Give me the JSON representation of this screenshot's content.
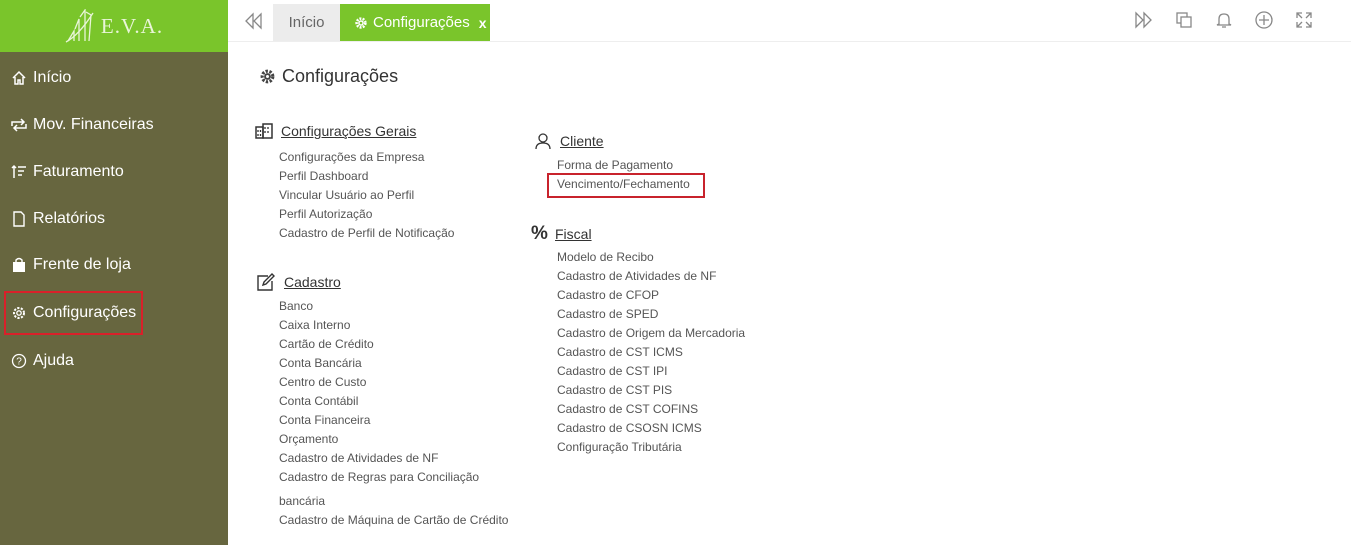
{
  "logo": {
    "text": "E.V.A."
  },
  "sidebar": {
    "items": [
      {
        "label": "Início",
        "icon": "home-icon"
      },
      {
        "label": "Mov. Financeiras",
        "icon": "swap-icon"
      },
      {
        "label": "Faturamento",
        "icon": "sort-icon"
      },
      {
        "label": "Relatórios",
        "icon": "file-icon"
      },
      {
        "label": "Frente de loja",
        "icon": "bag-icon"
      },
      {
        "label": "Configurações",
        "icon": "gear-icon"
      },
      {
        "label": "Ajuda",
        "icon": "help-icon"
      }
    ]
  },
  "tabs": [
    {
      "label": "Início"
    },
    {
      "label": "Configurações",
      "close": "x"
    }
  ],
  "page": {
    "title": "Configurações"
  },
  "sections": {
    "gerais": {
      "title": "Configurações Gerais",
      "items": [
        "Configurações da Empresa",
        "Perfil Dashboard",
        "Vincular Usuário ao Perfil",
        "Perfil Autorização",
        "Cadastro de Perfil de Notificação"
      ]
    },
    "cadastro": {
      "title": "Cadastro",
      "items": [
        "Banco",
        "Caixa Interno",
        "Cartão de Crédito",
        "Conta Bancária",
        "Centro de Custo",
        "Conta Contábil",
        "Conta Financeira",
        "Orçamento",
        "Cadastro de Atividades de NF",
        "Cadastro de Regras para Conciliação",
        "bancária",
        "Cadastro de Máquina de Cartão de Crédito"
      ]
    },
    "cliente": {
      "title": "Cliente",
      "items": [
        "Forma de Pagamento",
        "Vencimento/Fechamento"
      ]
    },
    "fiscal": {
      "title": "Fiscal",
      "items": [
        "Modelo de Recibo",
        "Cadastro de Atividades de NF",
        "Cadastro de CFOP",
        "Cadastro de SPED",
        "Cadastro de Origem da Mercadoria",
        "Cadastro de CST ICMS",
        "Cadastro de CST IPI",
        "Cadastro de CST PIS",
        "Cadastro de CST COFINS",
        "Cadastro de CSOSN ICMS",
        "Configuração Tributária"
      ]
    }
  },
  "colors": {
    "sidebar": "#67663f",
    "accent": "#7ac52b",
    "highlight": "#c8232c"
  }
}
